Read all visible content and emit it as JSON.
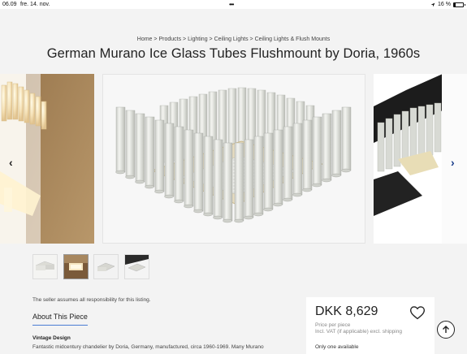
{
  "status_bar": {
    "time": "06.09",
    "date": "fre. 14. nov.",
    "dots": "•••",
    "battery_text": "16 %",
    "battery_level": 0.16
  },
  "breadcrumb": {
    "items": [
      "Home",
      "Products",
      "Lighting",
      "Ceiling Lights",
      "Ceiling Lights & Flush Mounts"
    ],
    "separator": " > "
  },
  "product": {
    "title": "German Murano Ice Glass Tubes Flushmount by Doria, 1960s"
  },
  "gallery": {
    "prev_icon": "chevron-left-icon",
    "next_icon": "chevron-right-icon",
    "prev_glyph": "‹",
    "next_glyph": "›",
    "thumbnail_count": 4
  },
  "listing": {
    "responsibility": "The seller assumes all responsibility for this listing.",
    "about_title": "About This Piece",
    "section_label": "Vintage Design",
    "description": "Fantastic midcentury chandelier by Doria, Germany, manufactured, circa 1960-1969. Many Murano"
  },
  "price_card": {
    "price": "DKK 8,629",
    "price_note": "Price per piece",
    "vat_note": "Incl. VAT (if applicable) excl. shipping",
    "availability": "Only one available",
    "favorite_icon": "heart-icon"
  },
  "scroll_top_icon": "arrow-up-icon",
  "colors": {
    "accent": "#4a7dd3",
    "next_arrow": "#1b3f8b",
    "background": "#f3f3f3"
  }
}
